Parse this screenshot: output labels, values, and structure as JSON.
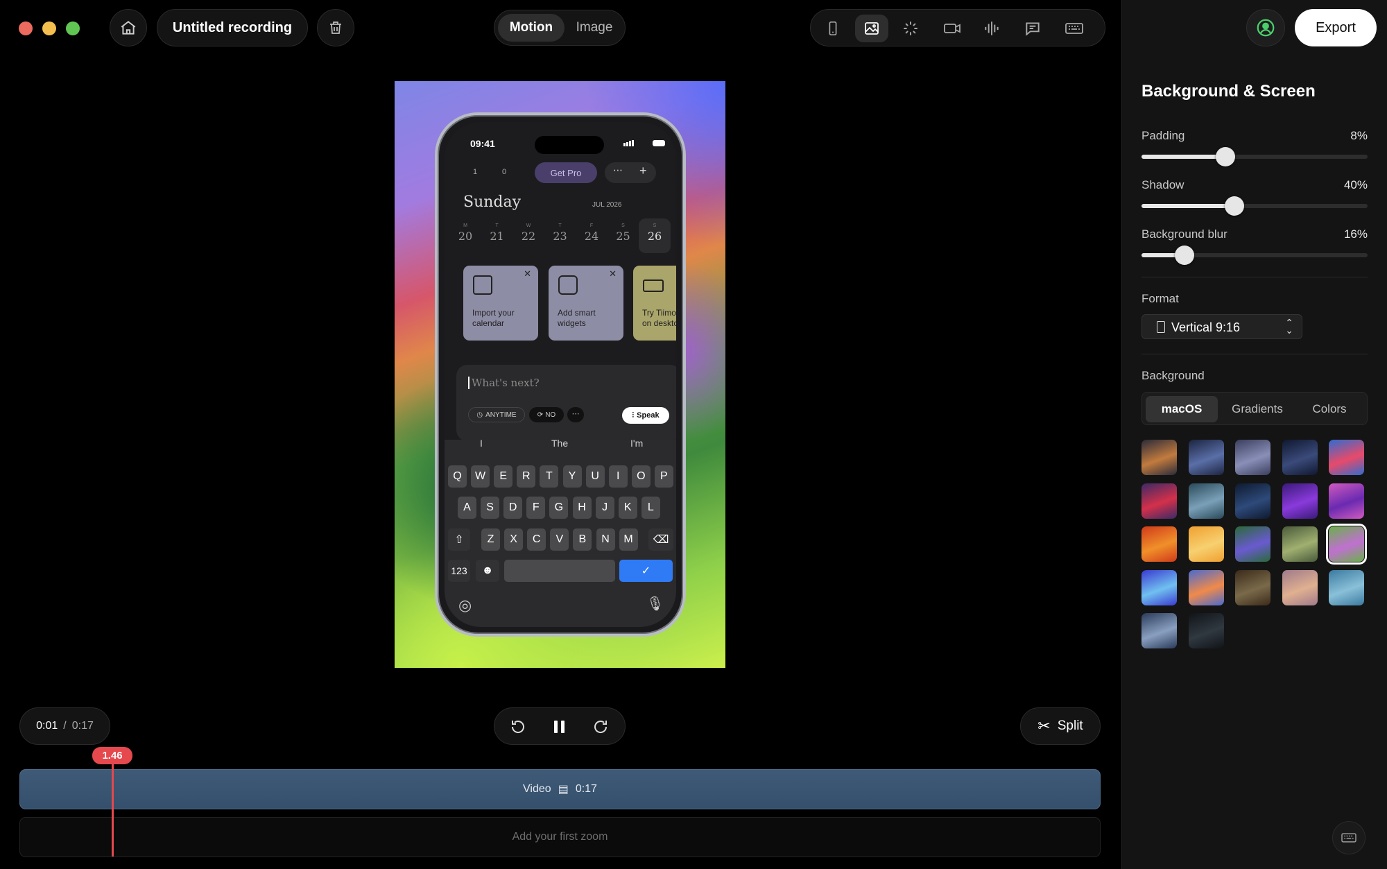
{
  "window": {
    "title": "Untitled recording"
  },
  "mode_toggle": {
    "motion": "Motion",
    "image": "Image"
  },
  "toolbar_icons": [
    "phone-icon",
    "image-icon",
    "sparkle-icon",
    "video-camera-icon",
    "audio-waveform-icon",
    "chat-bubble-icon",
    "keyboard-icon"
  ],
  "header": {
    "export_label": "Export"
  },
  "phone": {
    "time": "09:41",
    "counts": {
      "a": "1",
      "b": "0"
    },
    "get_pro": "Get Pro",
    "day": "Sunday",
    "month": "JUL 2026",
    "week": [
      {
        "dow": "M",
        "date": "20"
      },
      {
        "dow": "T",
        "date": "21"
      },
      {
        "dow": "W",
        "date": "22"
      },
      {
        "dow": "T",
        "date": "23"
      },
      {
        "dow": "F",
        "date": "24"
      },
      {
        "dow": "S",
        "date": "25"
      },
      {
        "dow": "S",
        "date": "26"
      }
    ],
    "cards": [
      {
        "title": "Import your calendar",
        "line1": "Import your",
        "line2": "calendar"
      },
      {
        "title": "Add smart widgets",
        "line1": "Add smart",
        "line2": "widgets"
      },
      {
        "title": "Try Tiimo on desktop",
        "line1": "Try Tiimo",
        "line2": "on desktc"
      }
    ],
    "input_placeholder": "What's next?",
    "chip_anytime": "ANYTIME",
    "chip_no": "NO",
    "speak": "Speak",
    "suggestions": [
      "I",
      "The",
      "I'm"
    ],
    "keyboard": {
      "row1": [
        "Q",
        "W",
        "E",
        "R",
        "T",
        "Y",
        "U",
        "I",
        "O",
        "P"
      ],
      "row2": [
        "A",
        "S",
        "D",
        "F",
        "G",
        "H",
        "J",
        "K",
        "L"
      ],
      "row3": [
        "Z",
        "X",
        "C",
        "V",
        "B",
        "N",
        "M"
      ],
      "numbers": "123"
    }
  },
  "playback": {
    "current": "0:01",
    "separator": "/",
    "total": "0:17",
    "split": "Split"
  },
  "timeline": {
    "playhead": "1.46",
    "video_label": "Video",
    "video_duration": "0:17",
    "zoom_hint": "Add your first zoom",
    "playhead_progress": 0.086
  },
  "sidebar": {
    "title": "Background & Screen",
    "sliders": [
      {
        "label": "Padding",
        "value_text": "8%",
        "fraction": 0.37
      },
      {
        "label": "Shadow",
        "value_text": "40%",
        "fraction": 0.41
      },
      {
        "label": "Background blur",
        "value_text": "16%",
        "fraction": 0.19
      }
    ],
    "format_label": "Format",
    "format_value": "Vertical 9:16",
    "background_label": "Background",
    "tabs": [
      "macOS",
      "Gradients",
      "Colors"
    ],
    "active_tab": "macOS",
    "wallpapers_count": 22,
    "selected_wallpaper": 14
  },
  "colors": {
    "accent_red": "#e5484d",
    "timeline_blue": "#3a5470",
    "confirm_blue": "#2f7bf6"
  }
}
